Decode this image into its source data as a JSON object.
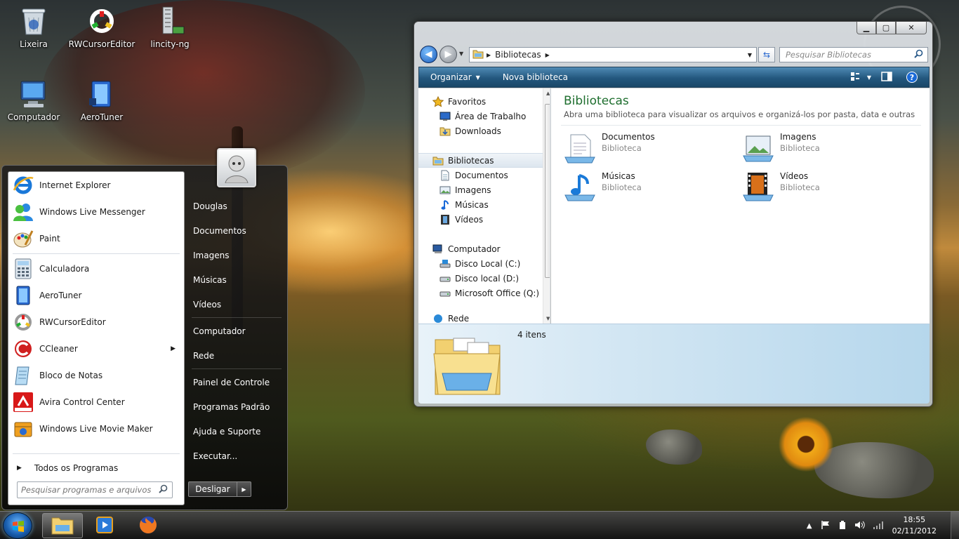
{
  "desktop": {
    "icons": [
      {
        "label": "Lixeira",
        "icon": "recycle-bin-icon"
      },
      {
        "label": "RWCursorEditor",
        "icon": "rwcursoreditor-icon"
      },
      {
        "label": "lincity-ng",
        "icon": "lincity-icon"
      },
      {
        "label": "Computador",
        "icon": "computer-icon"
      },
      {
        "label": "AeroTuner",
        "icon": "aerotuner-icon"
      }
    ]
  },
  "start_menu": {
    "programs": [
      {
        "label": "Internet Explorer",
        "icon": "internet-explorer-icon"
      },
      {
        "label": "Windows Live Messenger",
        "icon": "messenger-icon"
      },
      {
        "label": "Paint",
        "icon": "paint-icon"
      },
      {
        "label": "Calculadora",
        "icon": "calculator-icon"
      },
      {
        "label": "AeroTuner",
        "icon": "aerotuner-icon"
      },
      {
        "label": "RWCursorEditor",
        "icon": "rwcursoreditor-icon"
      },
      {
        "label": "CCleaner",
        "icon": "ccleaner-icon"
      },
      {
        "label": "Bloco de Notas",
        "icon": "notepad-icon"
      },
      {
        "label": "Avira Control Center",
        "icon": "avira-icon"
      },
      {
        "label": "Windows Live Movie Maker",
        "icon": "movie-maker-icon"
      }
    ],
    "all_programs": "Todos os Programas",
    "search_placeholder": "Pesquisar programas e arquivos",
    "right_items": {
      "user": "Douglas",
      "documents": "Documentos",
      "pictures": "Imagens",
      "music": "Músicas",
      "videos": "Vídeos",
      "computer": "Computador",
      "network": "Rede",
      "control_panel": "Painel de Controle",
      "default_programs": "Programas Padrão",
      "help": "Ajuda e Suporte",
      "run": "Executar..."
    },
    "shutdown": "Desligar"
  },
  "explorer": {
    "address_crumb": "Bibliotecas",
    "search_placeholder": "Pesquisar Bibliotecas",
    "toolbar": {
      "organize": "Organizar",
      "new_library": "Nova biblioteca"
    },
    "nav": {
      "favorites": "Favoritos",
      "desktop": "Área de Trabalho",
      "downloads": "Downloads",
      "libraries": "Bibliotecas",
      "documents": "Documentos",
      "pictures": "Imagens",
      "music": "Músicas",
      "videos": "Vídeos",
      "computer": "Computador",
      "disk_c": "Disco Local (C:)",
      "disk_d": "Disco local (D:)",
      "office": "Microsoft Office  (Q:)",
      "network": "Rede"
    },
    "content": {
      "title": "Bibliotecas",
      "description": "Abra uma biblioteca para visualizar os arquivos e organizá-los por pasta, data e outras propr...",
      "libraries": [
        {
          "name": "Documentos",
          "type": "Biblioteca"
        },
        {
          "name": "Imagens",
          "type": "Biblioteca"
        },
        {
          "name": "Músicas",
          "type": "Biblioteca"
        },
        {
          "name": "Vídeos",
          "type": "Biblioteca"
        }
      ]
    },
    "details": {
      "count": "4 itens"
    }
  },
  "taskbar": {
    "time": "18:55",
    "date": "02/11/2012"
  },
  "colors": {
    "accent": "#1e6e2e",
    "command_bar": "#23577e",
    "start_orb": "#1a5fb0"
  }
}
